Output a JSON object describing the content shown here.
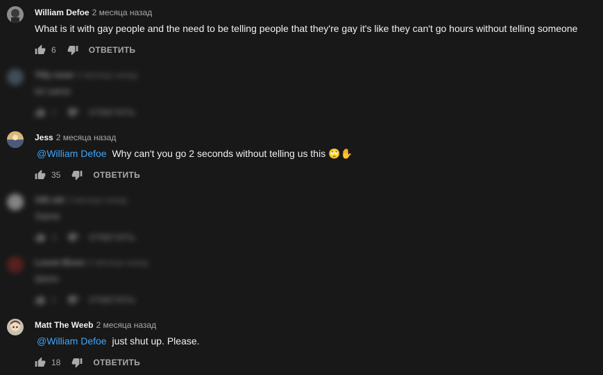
{
  "comments": [
    {
      "author": "William Defoe",
      "time": "2 месяца назад",
      "mention": "",
      "text": "What is it with gay people and the need to be telling people that they're gay it's like they can't go hours without telling someone",
      "likes": "6",
      "reply": "ОТВЕТИТЬ",
      "avatar_color": "#7a7a7a"
    },
    {
      "author": "Tilly rener",
      "time": "2 месяца назад",
      "mention": "",
      "text": "lol same",
      "likes": "1",
      "reply": "ОТВЕТИТЬ",
      "blurred": true,
      "avatar_color": "#5f7a8a"
    },
    {
      "author": "Jess",
      "time": "2 месяца назад",
      "mention": "@William Defoe",
      "text": "Why can't you go 2 seconds without telling us this 🙄✋",
      "likes": "35",
      "reply": "ОТВЕТИТЬ",
      "avatar_color": "#c9a56a"
    },
    {
      "author": "Villi sitt",
      "time": "2 месяца назад",
      "mention": "",
      "text": "Same",
      "likes": "3",
      "reply": "ОТВЕТИТЬ",
      "blurred": true,
      "avatar_color": "#dcdcdc"
    },
    {
      "author": "Lorem Bixen",
      "time": "2 месяца назад",
      "mention": "",
      "text": "damn",
      "likes": "1",
      "reply": "ОТВЕТИТЬ",
      "blurred": true,
      "avatar_color": "#8a2a22"
    },
    {
      "author": "Matt The Weeb",
      "time": "2 месяца назад",
      "mention": "@William Defoe",
      "text": "just shut up. Please.",
      "likes": "18",
      "reply": "ОТВЕТИТЬ",
      "avatar_color": "#b0a89a"
    }
  ]
}
